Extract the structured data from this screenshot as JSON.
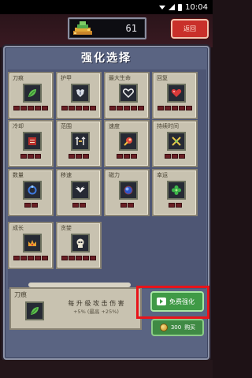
{
  "status_bar": {
    "time": "10:04"
  },
  "header": {
    "currency_value": "61",
    "currency_icon": "coin-pile-icon",
    "return_label": "返回"
  },
  "panel": {
    "title": "强化选择",
    "upgrades": [
      {
        "name": "刀痕",
        "icon": "green-leaf-icon",
        "level": 0,
        "max_level": 5
      },
      {
        "name": "护甲",
        "icon": "armor-icon",
        "level": 0,
        "max_level": 5
      },
      {
        "name": "最大生命",
        "icon": "heart-outline-icon",
        "level": 0,
        "max_level": 5
      },
      {
        "name": "回复",
        "icon": "heart-icon",
        "level": 0,
        "max_level": 5
      },
      {
        "name": "冷却",
        "icon": "red-book-icon",
        "level": 0,
        "max_level": 3
      },
      {
        "name": "范围",
        "icon": "range-arrows-icon",
        "level": 0,
        "max_level": 3
      },
      {
        "name": "速度",
        "icon": "fire-orb-icon",
        "level": 0,
        "max_level": 3
      },
      {
        "name": "持续时间",
        "icon": "crossed-swords-icon",
        "level": 0,
        "max_level": 3
      },
      {
        "name": "数量",
        "icon": "blue-ring-icon",
        "level": 0,
        "max_level": 2
      },
      {
        "name": "移速",
        "icon": "wings-icon",
        "level": 0,
        "max_level": 2
      },
      {
        "name": "磁力",
        "icon": "blue-orb-icon",
        "level": 0,
        "max_level": 2
      },
      {
        "name": "幸运",
        "icon": "clover-icon",
        "level": 0,
        "max_level": 2
      },
      {
        "name": "成长",
        "icon": "crown-icon",
        "level": 0,
        "max_level": 5
      },
      {
        "name": "贪婪",
        "icon": "skull-icon",
        "level": 0,
        "max_level": 5
      }
    ]
  },
  "detail": {
    "title": "刀痕",
    "icon": "green-leaf-icon",
    "description": "每 升 级 攻 击 伤 害",
    "sub_description": "+5% (最高 +25%)"
  },
  "actions": {
    "free_label": "免费强化",
    "buy_price": "300",
    "buy_label": "购买"
  },
  "colors": {
    "panel_bg": "#5a6482",
    "card_bg": "#c8c2b0",
    "level_off": "#6a1f24",
    "free_button": "#3f9a46",
    "return_button": "#c9302a",
    "highlight": "#e8141a"
  }
}
